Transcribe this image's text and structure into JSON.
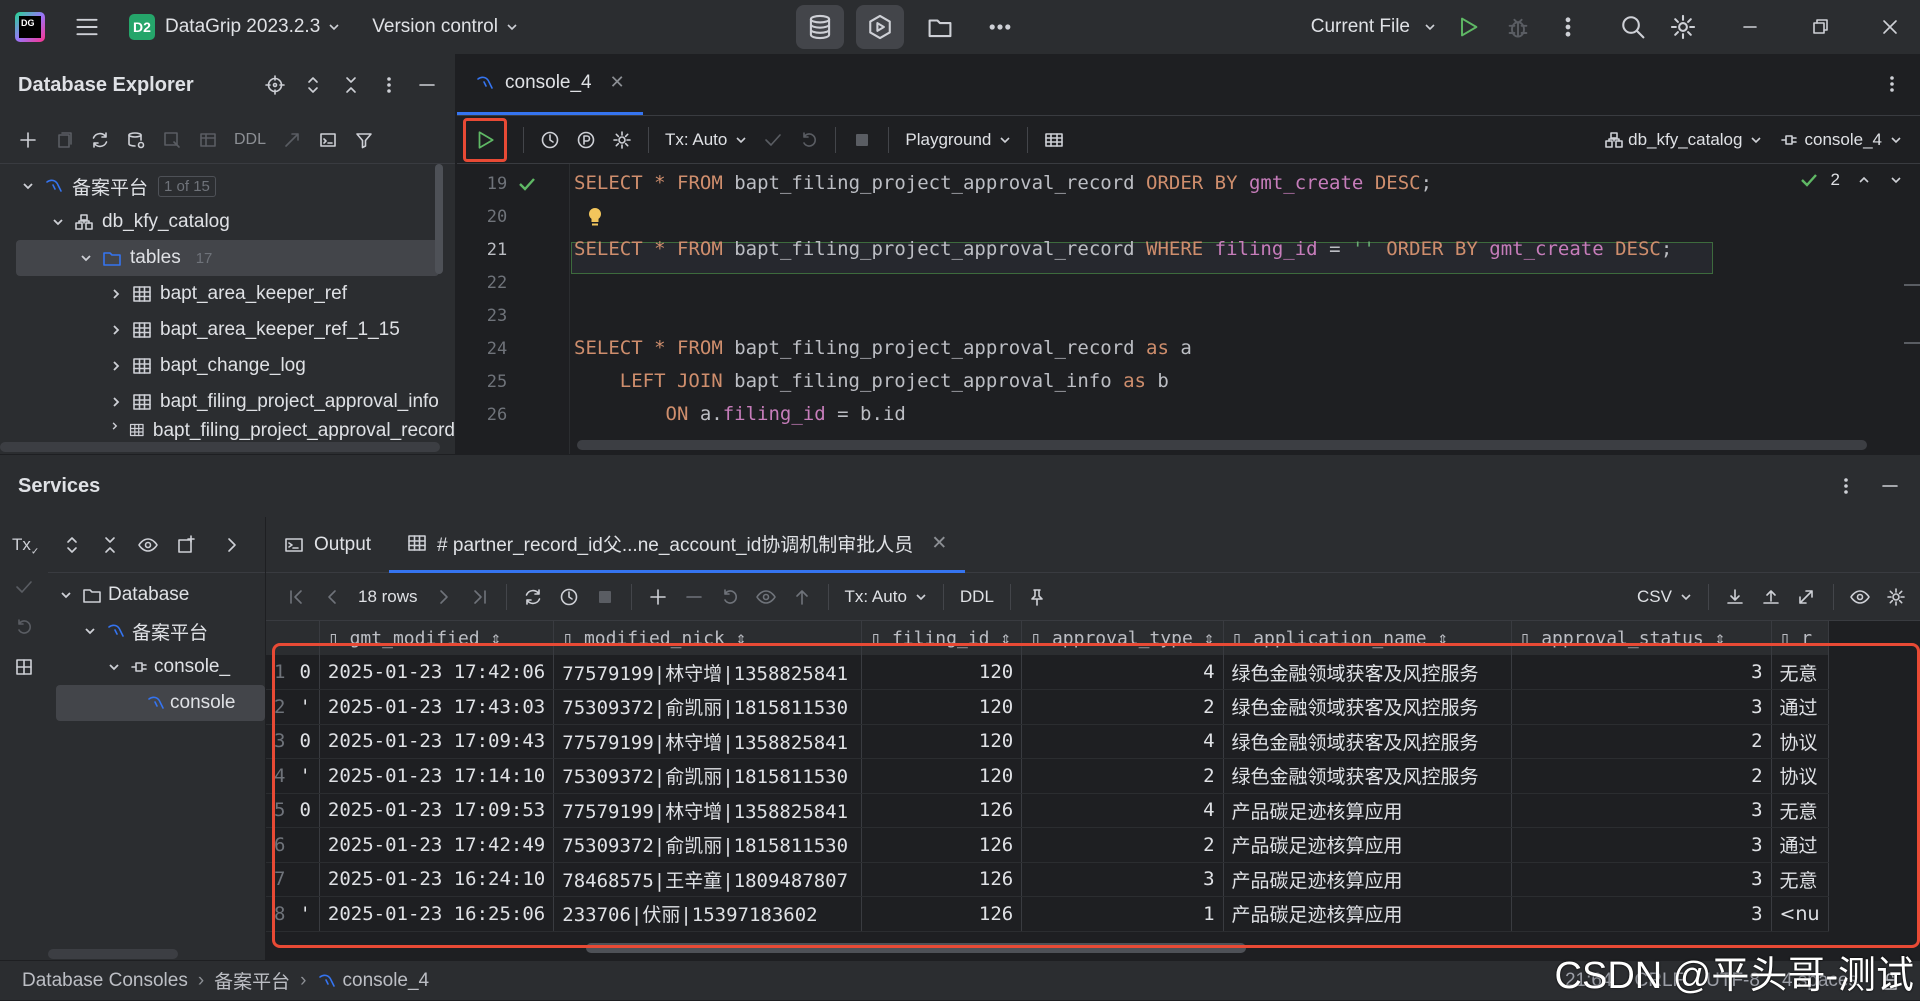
{
  "titlebar": {
    "app_badge": "D2",
    "app_name": "DataGrip 2023.2.3",
    "vcs": "Version control",
    "run_config": "Current File"
  },
  "db_explorer": {
    "title": "Database Explorer",
    "ddl": "DDL",
    "tree": {
      "root": "备案平台",
      "root_count": "1 of 15",
      "catalog": "db_kfy_catalog",
      "tables_folder": "tables",
      "tables_count": "17",
      "tables": [
        "bapt_area_keeper_ref",
        "bapt_area_keeper_ref_1_15",
        "bapt_change_log",
        "bapt_filing_project_approval_info",
        "bapt_filing_project_approval_record"
      ]
    }
  },
  "editor": {
    "tab": "console_4",
    "tx_mode": "Tx: Auto",
    "playground": "Playground",
    "schema": "db_kfy_catalog",
    "session": "console_4",
    "check_count": "2",
    "lines": [
      {
        "n": "19",
        "code": "SELECT * FROM bapt_filing_project_approval_record ORDER BY gmt_create DESC;"
      },
      {
        "n": "20",
        "code": ""
      },
      {
        "n": "21",
        "code": "SELECT * FROM bapt_filing_project_approval_record WHERE filing_id = '' ORDER BY gmt_create DESC;"
      },
      {
        "n": "22",
        "code": ""
      },
      {
        "n": "23",
        "code": ""
      },
      {
        "n": "24",
        "code": "SELECT * FROM bapt_filing_project_approval_record as a"
      },
      {
        "n": "25",
        "code": "    LEFT JOIN bapt_filing_project_approval_info as b"
      },
      {
        "n": "26",
        "code": "        ON a.filing_id = b.id"
      }
    ]
  },
  "services": {
    "title": "Services",
    "tree": {
      "database": "Database",
      "datasource": "备案平台",
      "console": "console_",
      "session": "console"
    },
    "tabs": {
      "output": "Output",
      "result": "# partner_record_id父...ne_account_id协调机制审批人员"
    },
    "grid_toolbar": {
      "rows": "18 rows",
      "tx_mode": "Tx: Auto",
      "ddl": "DDL",
      "export_format": "CSV"
    },
    "columns": [
      "gmt_modified",
      "modified_nick",
      "filing_id",
      "approval_type",
      "application_name",
      "approval_status",
      "r"
    ],
    "rows": [
      {
        "n": "1",
        "lead": "0",
        "gmt_modified": "2025-01-23 17:42:06",
        "modified_nick": "77579199|林守增|1358825841",
        "filing_id": "120",
        "approval_type": "4",
        "application_name": "绿色金融领域获客及风控服务",
        "approval_status": "3",
        "r": "无意"
      },
      {
        "n": "2",
        "lead": "'",
        "gmt_modified": "2025-01-23 17:43:03",
        "modified_nick": "75309372|俞凯丽|1815811530",
        "filing_id": "120",
        "approval_type": "2",
        "application_name": "绿色金融领域获客及风控服务",
        "approval_status": "3",
        "r": "通过"
      },
      {
        "n": "3",
        "lead": "0",
        "gmt_modified": "2025-01-23 17:09:43",
        "modified_nick": "77579199|林守增|1358825841",
        "filing_id": "120",
        "approval_type": "4",
        "application_name": "绿色金融领域获客及风控服务",
        "approval_status": "2",
        "r": "协议"
      },
      {
        "n": "4",
        "lead": "'",
        "gmt_modified": "2025-01-23 17:14:10",
        "modified_nick": "75309372|俞凯丽|1815811530",
        "filing_id": "120",
        "approval_type": "2",
        "application_name": "绿色金融领域获客及风控服务",
        "approval_status": "2",
        "r": "协议"
      },
      {
        "n": "5",
        "lead": "0",
        "gmt_modified": "2025-01-23 17:09:53",
        "modified_nick": "77579199|林守增|1358825841",
        "filing_id": "126",
        "approval_type": "4",
        "application_name": "产品碳足迹核算应用",
        "approval_status": "3",
        "r": "无意"
      },
      {
        "n": "6",
        "lead": "",
        "gmt_modified": "2025-01-23 17:42:49",
        "modified_nick": "75309372|俞凯丽|1815811530",
        "filing_id": "126",
        "approval_type": "2",
        "application_name": "产品碳足迹核算应用",
        "approval_status": "3",
        "r": "通过"
      },
      {
        "n": "7",
        "lead": "",
        "gmt_modified": "2025-01-23 16:24:10",
        "modified_nick": "78468575|王辛童|1809487807",
        "filing_id": "126",
        "approval_type": "3",
        "application_name": "产品碳足迹核算应用",
        "approval_status": "3",
        "r": "无意"
      },
      {
        "n": "8",
        "lead": "'",
        "gmt_modified": "2025-01-23 16:25:06",
        "modified_nick": "233706|伏丽|15397183602",
        "filing_id": "126",
        "approval_type": "1",
        "application_name": "产品碳足迹核算应用",
        "approval_status": "3",
        "r": "<nu"
      }
    ]
  },
  "statusbar": {
    "crumbs": [
      "Database Consoles",
      "备案平台",
      "console_4"
    ],
    "position": "21:64",
    "line_sep": "CRLF",
    "encoding": "UTF-8",
    "indent": "4 spaces"
  },
  "watermark": "CSDN @平头哥-测试",
  "colors": {
    "accent": "#3574f0",
    "highlight_box": "#e84a35",
    "run_green": "#5fb865"
  }
}
